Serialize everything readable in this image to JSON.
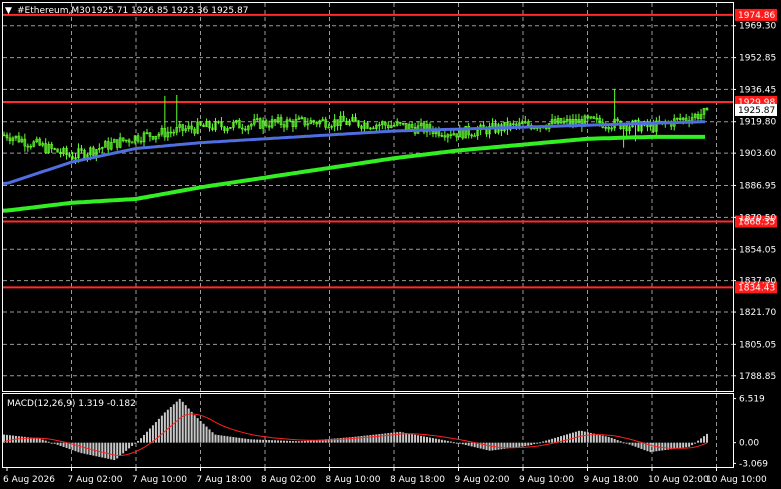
{
  "header": {
    "symbol_text": "#Ethereum,M30",
    "ohlc_text": "1925.71 1926.85 1923.36 1925.87",
    "collapse_glyph": "▼"
  },
  "colors": {
    "background": "#000000",
    "grid": "#9a9a9a",
    "candle": "#66ff33",
    "ma_blue": "#4f6fe0",
    "ma_green": "#33ee22",
    "level_line": "#ff2a2a",
    "level_tag_bg": "#ff1a1a",
    "price_tag_bg": "#ffffff",
    "macd_hist": "#c8c8c8",
    "macd_signal": "#ff2020",
    "axis_text": "#ffffff"
  },
  "price_axis": {
    "labels": [
      "1969.30",
      "1952.85",
      "1936.45",
      "1919.80",
      "1903.60",
      "1886.95",
      "1870.50",
      "1854.05",
      "1837.90",
      "1821.70",
      "1805.05",
      "1788.85"
    ],
    "range": [
      1781.0,
      1981.0
    ]
  },
  "levels": [
    {
      "price": 1974.86,
      "label": "1974.86"
    },
    {
      "price": 1929.98,
      "label": "1929.98"
    },
    {
      "price": 1868.35,
      "label": "1868.35"
    },
    {
      "price": 1834.43,
      "label": "1834.43"
    }
  ],
  "current_price": {
    "price": 1925.87,
    "label": "1925.87"
  },
  "time_axis": {
    "labels": [
      "6 Aug 2026",
      "7 Aug 02:00",
      "7 Aug 10:00",
      "7 Aug 18:00",
      "8 Aug 02:00",
      "8 Aug 10:00",
      "8 Aug 18:00",
      "9 Aug 02:00",
      "9 Aug 10:00",
      "9 Aug 18:00",
      "10 Aug 02:00",
      "10 Aug 10:00"
    ]
  },
  "macd": {
    "title": "MACD(12,26,9) 1.319 -0.182",
    "axis_labels": [
      "6.519",
      "0.00",
      "-3.069"
    ],
    "range": [
      -3.6,
      7.2
    ]
  },
  "chart_data": {
    "type": "candlestick",
    "symbol": "#Ethereum",
    "timeframe": "M30",
    "last_bar": {
      "open": 1925.71,
      "high": 1926.85,
      "low": 1923.36,
      "close": 1925.87
    },
    "horizontal_levels": [
      1974.86,
      1929.98,
      1868.35,
      1834.43
    ],
    "indicator": {
      "name": "MACD(12,26,9)",
      "main": 1.319,
      "signal": -0.182
    },
    "close_path": [
      [
        "6 Aug 2026",
        1913
      ],
      [
        "7 Aug 02:00",
        1902
      ],
      [
        "7 Aug 10:00",
        1912
      ],
      [
        "7 Aug 18:00",
        1917
      ],
      [
        "8 Aug 02:00",
        1919
      ],
      [
        "8 Aug 10:00",
        1920
      ],
      [
        "8 Aug 18:00",
        1918
      ],
      [
        "9 Aug 02:00",
        1914
      ],
      [
        "9 Aug 10:00",
        1918
      ],
      [
        "9 Aug 18:00",
        1920
      ],
      [
        "10 Aug 02:00",
        1917
      ],
      [
        "10 Aug 10:00",
        1925.87
      ]
    ],
    "ma_blue": [
      [
        "6 Aug 2026",
        1888
      ],
      [
        "7 Aug 02:00",
        1899
      ],
      [
        "7 Aug 10:00",
        1906
      ],
      [
        "7 Aug 18:00",
        1909
      ],
      [
        "8 Aug 02:00",
        1911
      ],
      [
        "8 Aug 10:00",
        1913
      ],
      [
        "8 Aug 18:00",
        1915
      ],
      [
        "9 Aug 02:00",
        1916
      ],
      [
        "9 Aug 10:00",
        1917
      ],
      [
        "9 Aug 18:00",
        1918
      ],
      [
        "10 Aug 02:00",
        1919
      ],
      [
        "10 Aug 10:00",
        1920
      ]
    ],
    "ma_green": [
      [
        "6 Aug 2026",
        1874
      ],
      [
        "7 Aug 02:00",
        1878
      ],
      [
        "7 Aug 10:00",
        1880
      ],
      [
        "7 Aug 18:00",
        1886
      ],
      [
        "8 Aug 02:00",
        1891
      ],
      [
        "8 Aug 10:00",
        1896
      ],
      [
        "8 Aug 18:00",
        1901
      ],
      [
        "9 Aug 02:00",
        1905
      ],
      [
        "9 Aug 10:00",
        1908
      ],
      [
        "9 Aug 18:00",
        1911
      ],
      [
        "10 Aug 02:00",
        1912
      ],
      [
        "10 Aug 10:00",
        1912
      ]
    ]
  }
}
